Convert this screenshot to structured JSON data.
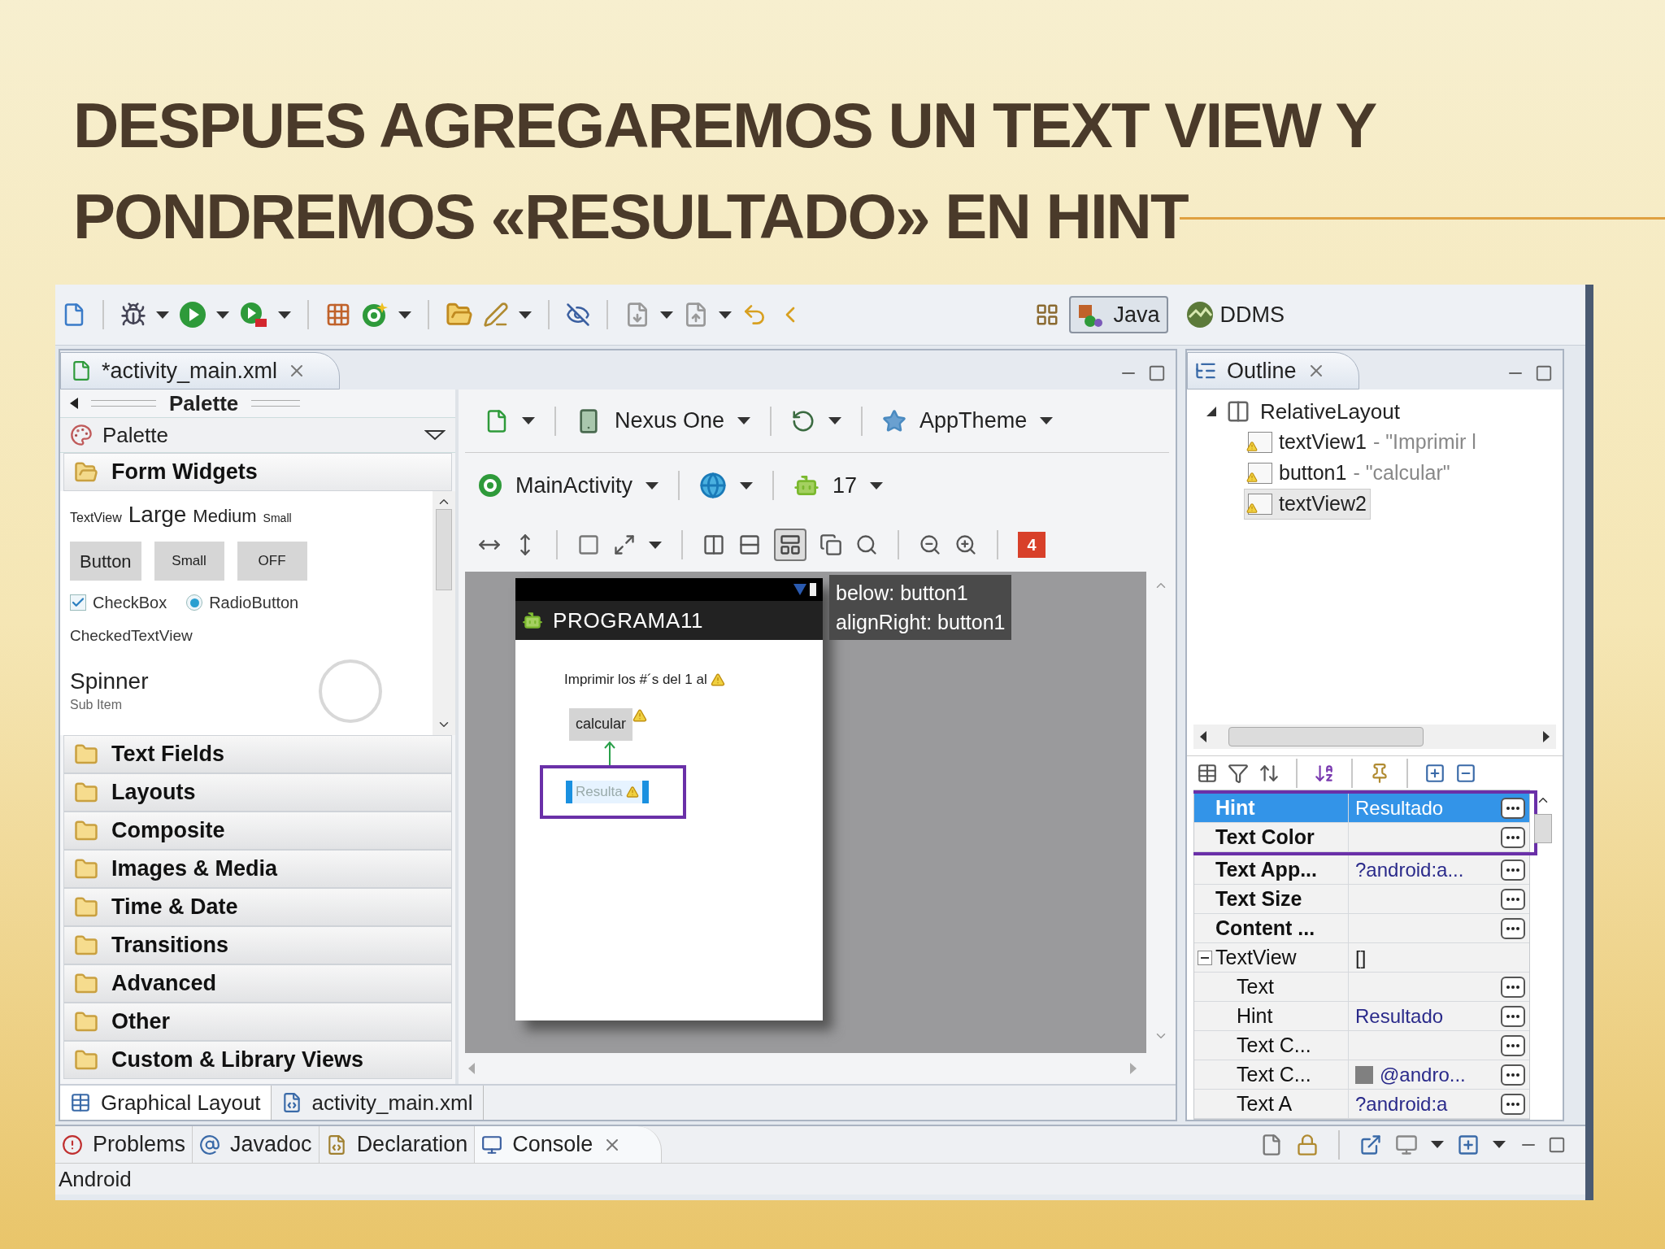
{
  "slide": {
    "title_lines": [
      "DESPUES AGREGAREMOS UN TEXT VIEW Y",
      "PONDREMOS «RESULTADO» EN HINT"
    ]
  },
  "perspectives": [
    {
      "label": "Java",
      "selected": true
    },
    {
      "label": "DDMS",
      "selected": false
    }
  ],
  "editor": {
    "tab": "*activity_main.xml"
  },
  "palette": {
    "header": "Palette",
    "selector": "Palette",
    "categories": [
      {
        "label": "Form Widgets",
        "expanded": true
      },
      {
        "label": "Text Fields",
        "expanded": false
      },
      {
        "label": "Layouts",
        "expanded": false
      },
      {
        "label": "Composite",
        "expanded": false
      },
      {
        "label": "Images & Media",
        "expanded": false
      },
      {
        "label": "Time & Date",
        "expanded": false
      },
      {
        "label": "Transitions",
        "expanded": false
      },
      {
        "label": "Advanced",
        "expanded": false
      },
      {
        "label": "Other",
        "expanded": false
      },
      {
        "label": "Custom & Library Views",
        "expanded": false
      }
    ],
    "form_widgets": {
      "text_styles": [
        "TextView",
        "Large",
        "Medium",
        "Small"
      ],
      "buttons": [
        "Button",
        "Small",
        "OFF"
      ],
      "checkbox": {
        "label": "CheckBox",
        "checked": true
      },
      "radio": {
        "label": "RadioButton",
        "selected": true
      },
      "checked_text_view": "CheckedTextView",
      "spinner": {
        "label": "Spinner",
        "sub": "Sub Item"
      }
    }
  },
  "canvas_toolbar": {
    "device": "Nexus One",
    "theme": "AppTheme",
    "activity": "MainActivity",
    "api": "17",
    "error_count": "4"
  },
  "preview": {
    "app_title": "PROGRAMA11",
    "label_text": "Imprimir los #´s del 1 al",
    "button_text": "calcular",
    "hint_text": "Resulta",
    "tooltip": [
      "below: button1",
      "alignRight: button1"
    ]
  },
  "layout_tabs": [
    {
      "label": "Graphical Layout",
      "selected": true
    },
    {
      "label": "activity_main.xml",
      "selected": false
    }
  ],
  "outline": {
    "title": "Outline",
    "tree": [
      {
        "label": "RelativeLayout",
        "expanded": true,
        "children": [
          {
            "label": "textView1",
            "detail": "- \"Imprimir l",
            "selected": false
          },
          {
            "label": "button1",
            "detail": "- \"calcular\"",
            "selected": false
          },
          {
            "label": "textView2",
            "selected": true
          }
        ]
      }
    ]
  },
  "properties": {
    "rows": [
      {
        "kind": "property",
        "name": "Hint",
        "value": "Resultado",
        "bold": true,
        "selected": true
      },
      {
        "kind": "property",
        "name": "Text Color",
        "bold": true,
        "selected": false
      },
      {
        "kind": "property",
        "name": "Text App...",
        "value": "?android:a...",
        "bold": true,
        "selected": false
      },
      {
        "kind": "property",
        "name": "Text Size",
        "bold": true,
        "selected": false
      },
      {
        "kind": "property",
        "name": "Content ...",
        "bold": true,
        "selected": false
      },
      {
        "kind": "group",
        "name": "TextView",
        "value": "[]",
        "expanded": true,
        "children": [
          {
            "kind": "property",
            "name": "Text",
            "bold": false,
            "selected": false
          },
          {
            "kind": "property",
            "name": "Hint",
            "value": "Resultado",
            "bold": false,
            "selected": false
          },
          {
            "kind": "property",
            "name": "Text C...",
            "bold": false,
            "selected": false
          },
          {
            "kind": "property",
            "name": "Text C...",
            "value": "@andro...",
            "color": "#808080",
            "bold": false,
            "selected": false
          },
          {
            "kind": "property",
            "name": "Text A",
            "value": "?android:a",
            "bold": false,
            "selected": false
          }
        ]
      }
    ]
  },
  "views": [
    {
      "label": "Problems",
      "selected": false
    },
    {
      "label": "Javadoc",
      "selected": false
    },
    {
      "label": "Declaration",
      "selected": false
    },
    {
      "label": "Console",
      "selected": true
    }
  ],
  "console_text": "Android"
}
